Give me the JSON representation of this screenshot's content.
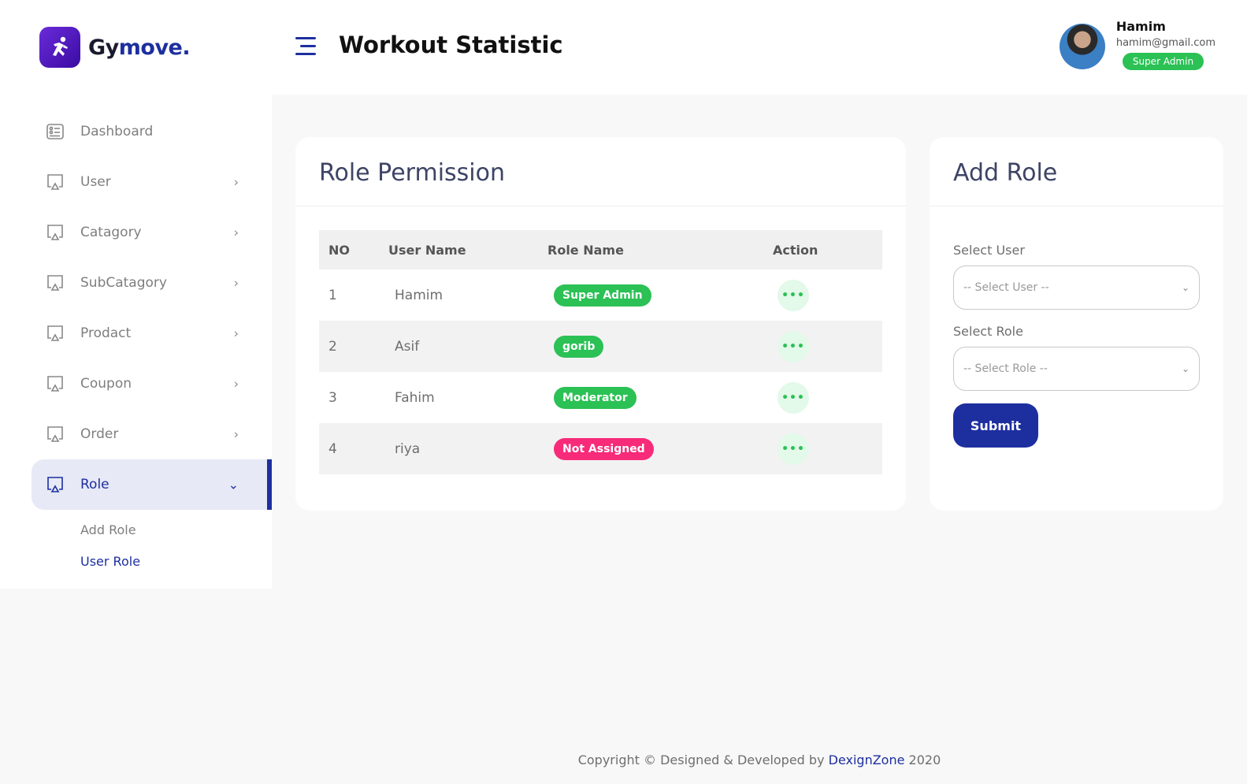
{
  "brand": {
    "name_part1": "Gy",
    "name_part2": "move.",
    "logo_icon": "running-person-icon"
  },
  "header": {
    "title": "Workout Statistic",
    "menu_icon": "hamburger-icon"
  },
  "profile": {
    "name": "Hamim",
    "email": "hamim@gmail.com",
    "badge": "Super Admin"
  },
  "sidebar": {
    "items": [
      {
        "label": "Dashboard",
        "icon": "dashboard-icon",
        "has_chevron": false
      },
      {
        "label": "User",
        "icon": "monitor-icon",
        "has_chevron": true
      },
      {
        "label": "Catagory",
        "icon": "monitor-icon",
        "has_chevron": true
      },
      {
        "label": "SubCatagory",
        "icon": "monitor-icon",
        "has_chevron": true
      },
      {
        "label": "Prodact",
        "icon": "monitor-icon",
        "has_chevron": true
      },
      {
        "label": "Coupon",
        "icon": "monitor-icon",
        "has_chevron": true
      },
      {
        "label": "Order",
        "icon": "monitor-icon",
        "has_chevron": true
      },
      {
        "label": "Role",
        "icon": "monitor-icon",
        "has_chevron": true,
        "active": true
      }
    ],
    "submenu": [
      {
        "label": "Add Role"
      },
      {
        "label": "User Role",
        "current": true
      }
    ]
  },
  "role_permission": {
    "title": "Role Permission",
    "columns": [
      "NO",
      "User Name",
      "Role Name",
      "Action"
    ],
    "rows": [
      {
        "no": "1",
        "user": "Hamim",
        "role": "Super Admin",
        "role_color": "green"
      },
      {
        "no": "2",
        "user": "Asif",
        "role": "gorib",
        "role_color": "green"
      },
      {
        "no": "3",
        "user": "Fahim",
        "role": "Moderator",
        "role_color": "green"
      },
      {
        "no": "4",
        "user": "riya",
        "role": "Not Assigned",
        "role_color": "pink"
      }
    ],
    "action_label": "•••"
  },
  "add_role": {
    "title": "Add Role",
    "select_user_label": "Select User",
    "select_user_value": "-- Select User --",
    "select_role_label": "Select Role",
    "select_role_value": "-- Select Role --",
    "submit_label": "Submit"
  },
  "footer": {
    "prefix": "Copyright © Designed & Developed by ",
    "link": "DexignZone",
    "suffix": " 2020"
  },
  "colors": {
    "primary": "#1d2f9f",
    "success": "#2bc155",
    "danger": "#f72b79",
    "background": "#f8f8f8"
  }
}
